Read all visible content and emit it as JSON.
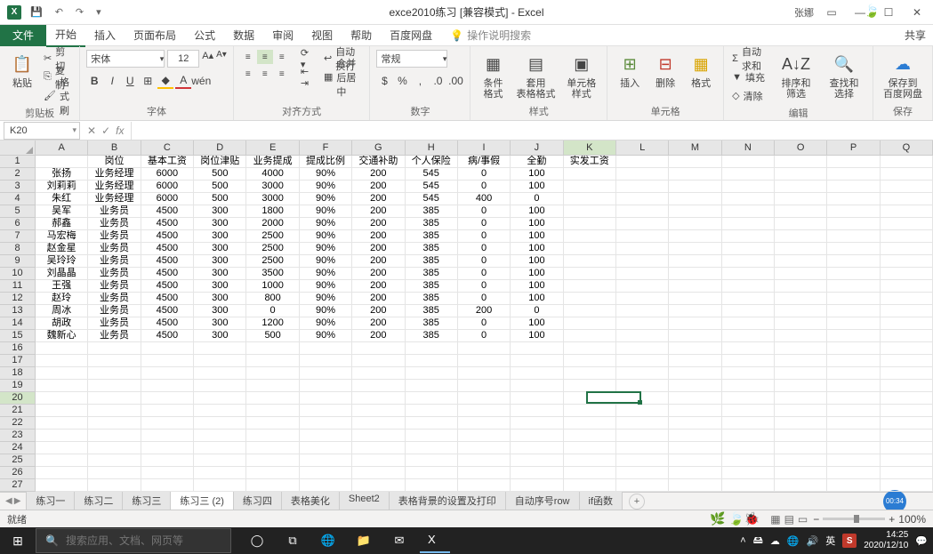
{
  "window": {
    "title": "exce2010练习 [兼容模式] - Excel",
    "user": "张娜"
  },
  "tabs": {
    "file": "文件",
    "items": [
      "开始",
      "插入",
      "页面布局",
      "公式",
      "数据",
      "审阅",
      "视图",
      "帮助",
      "百度网盘"
    ],
    "active_index": 0,
    "tell_me": "操作说明搜索",
    "share": "共享"
  },
  "ribbon": {
    "clipboard": {
      "paste": "粘贴",
      "cut": "剪切",
      "copy": "复制",
      "format_painter": "格式刷",
      "label": "剪贴板"
    },
    "font": {
      "name": "宋体",
      "size": "12",
      "label": "字体"
    },
    "alignment": {
      "wrap": "自动换行",
      "merge": "合并后居中",
      "label": "对齐方式"
    },
    "number": {
      "format": "常规",
      "label": "数字"
    },
    "styles": {
      "cond": "条件格式",
      "table": "套用\n表格格式",
      "cell": "单元格样式",
      "label": "样式"
    },
    "cells": {
      "insert": "插入",
      "delete": "删除",
      "format": "格式",
      "label": "单元格"
    },
    "editing": {
      "autosum": "自动求和",
      "fill": "填充",
      "clear": "清除",
      "sort": "排序和筛选",
      "find": "查找和选择",
      "label": "编辑"
    },
    "save": {
      "btn": "保存到\n百度网盘",
      "label": "保存"
    }
  },
  "formula_bar": {
    "name_box": "K20",
    "formula": ""
  },
  "columns": [
    "A",
    "B",
    "C",
    "D",
    "E",
    "F",
    "G",
    "H",
    "I",
    "J",
    "K",
    "L",
    "M",
    "N",
    "O",
    "P",
    "Q"
  ],
  "active_col": "K",
  "row_count": 27,
  "active_row": 20,
  "headers": [
    "",
    "岗位",
    "基本工资",
    "岗位津贴",
    "业务提成",
    "提成比例",
    "交通补助",
    "个人保险",
    "病/事假",
    "全勤",
    "实发工资"
  ],
  "rows": [
    [
      "张扬",
      "业务经理",
      "6000",
      "500",
      "4000",
      "90%",
      "200",
      "545",
      "0",
      "100",
      ""
    ],
    [
      "刘莉莉",
      "业务经理",
      "6000",
      "500",
      "3000",
      "90%",
      "200",
      "545",
      "0",
      "100",
      ""
    ],
    [
      "朱红",
      "业务经理",
      "6000",
      "500",
      "3000",
      "90%",
      "200",
      "545",
      "400",
      "0",
      ""
    ],
    [
      "吴军",
      "业务员",
      "4500",
      "300",
      "1800",
      "90%",
      "200",
      "385",
      "0",
      "100",
      ""
    ],
    [
      "郝鑫",
      "业务员",
      "4500",
      "300",
      "2000",
      "90%",
      "200",
      "385",
      "0",
      "100",
      ""
    ],
    [
      "马宏梅",
      "业务员",
      "4500",
      "300",
      "2500",
      "90%",
      "200",
      "385",
      "0",
      "100",
      ""
    ],
    [
      "赵金星",
      "业务员",
      "4500",
      "300",
      "2500",
      "90%",
      "200",
      "385",
      "0",
      "100",
      ""
    ],
    [
      "吴玲玲",
      "业务员",
      "4500",
      "300",
      "2500",
      "90%",
      "200",
      "385",
      "0",
      "100",
      ""
    ],
    [
      "刘晶晶",
      "业务员",
      "4500",
      "300",
      "3500",
      "90%",
      "200",
      "385",
      "0",
      "100",
      ""
    ],
    [
      "王强",
      "业务员",
      "4500",
      "300",
      "1000",
      "90%",
      "200",
      "385",
      "0",
      "100",
      ""
    ],
    [
      "赵玲",
      "业务员",
      "4500",
      "300",
      "800",
      "90%",
      "200",
      "385",
      "0",
      "100",
      ""
    ],
    [
      "周冰",
      "业务员",
      "4500",
      "300",
      "0",
      "90%",
      "200",
      "385",
      "200",
      "0",
      ""
    ],
    [
      "胡政",
      "业务员",
      "4500",
      "300",
      "1200",
      "90%",
      "200",
      "385",
      "0",
      "100",
      ""
    ],
    [
      "魏新心",
      "业务员",
      "4500",
      "300",
      "500",
      "90%",
      "200",
      "385",
      "0",
      "100",
      ""
    ]
  ],
  "sheets": {
    "items": [
      "练习一",
      "练习二",
      "练习三",
      "练习三 (2)",
      "练习四",
      "表格美化",
      "Sheet2",
      "表格背景的设置及打印",
      "自动序号row",
      "if函数"
    ],
    "active_index": 3
  },
  "status": {
    "ready": "就绪",
    "zoom": "100%",
    "timer": "00:34"
  },
  "taskbar": {
    "search_placeholder": "搜索应用、文档、网页等",
    "ime": "英",
    "time": "14:25",
    "date": "2020/12/10"
  }
}
